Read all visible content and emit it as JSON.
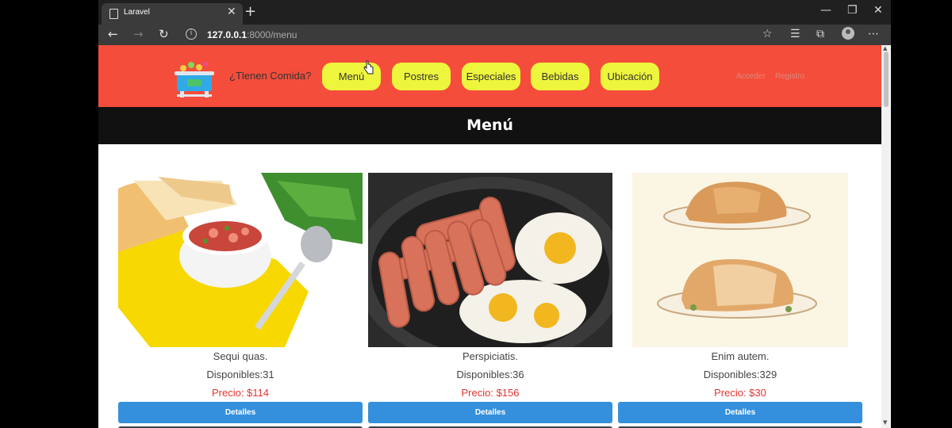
{
  "browser": {
    "tab_title": "Laravel",
    "url_host": "127.0.0.1",
    "url_rest": ":8000/menu"
  },
  "navbar": {
    "brand": "¿Tlenen Comida?",
    "items": [
      {
        "label": "Menú"
      },
      {
        "label": "Postres"
      },
      {
        "label": "Especiales"
      },
      {
        "label": "Bebidas"
      },
      {
        "label": "Ubicación"
      }
    ],
    "login": "Acceder",
    "register": "Registro"
  },
  "page": {
    "title": "Menú"
  },
  "products": [
    {
      "name": "Sequi quas.",
      "stock": "Disponibles:31",
      "price": "Precio: $114",
      "button": "Detalles"
    },
    {
      "name": "Perspiciatis.",
      "stock": "Disponibles:36",
      "price": "Precio: $156",
      "button": "Detalles"
    },
    {
      "name": "Enim autem.",
      "stock": "Disponibles:329",
      "price": "Precio: $30",
      "button": "Detalles"
    }
  ],
  "colors": {
    "navbar_bg": "#f54d3b",
    "pill_bg": "#eef53d",
    "title_bar_bg": "#111111",
    "button_bg": "#3490dc",
    "price_text": "#e3342f"
  }
}
